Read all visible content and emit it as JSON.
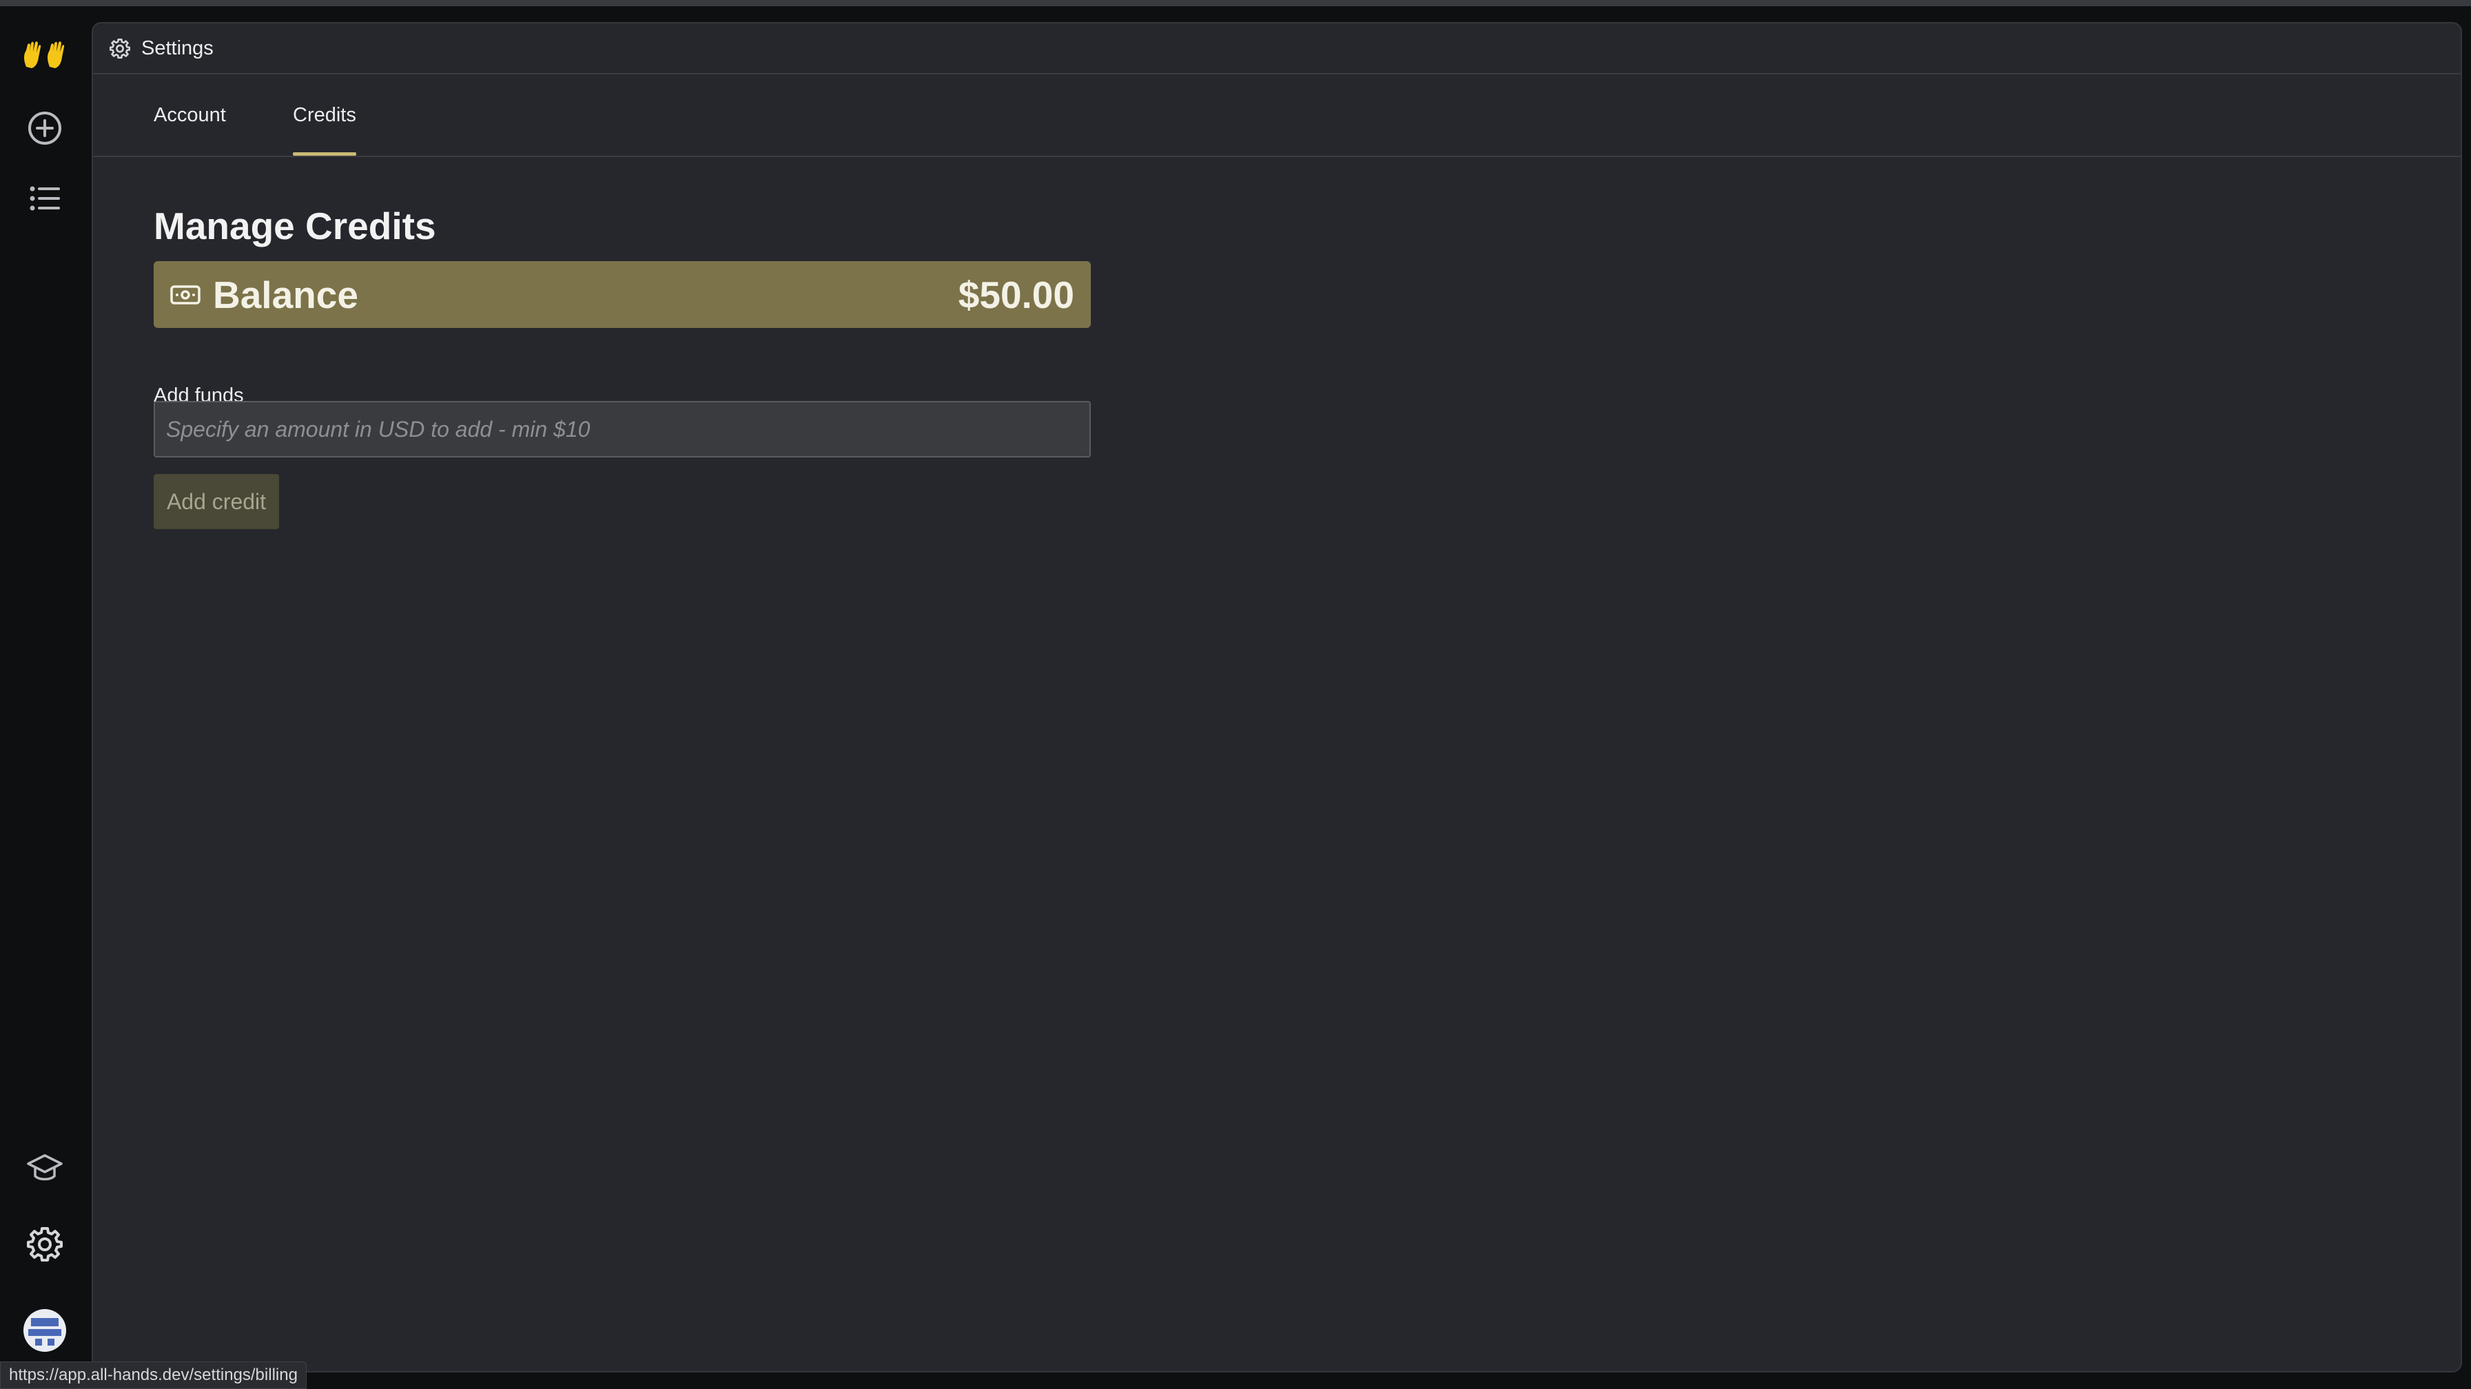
{
  "app": {
    "logo_icon": "raised-hands-icon",
    "brand_color": "#f5c518"
  },
  "sidebar": {
    "items": [
      {
        "icon": "plus-circle-icon",
        "action": "new-conversation"
      },
      {
        "icon": "list-icon",
        "action": "conversations"
      },
      {
        "icon": "graduation-cap-icon",
        "action": "docs"
      },
      {
        "icon": "gear-icon",
        "action": "settings"
      },
      {
        "icon": "avatar",
        "action": "user-menu"
      }
    ]
  },
  "header": {
    "title": "Settings",
    "icon": "gear-icon"
  },
  "tabs": [
    {
      "label": "Account",
      "active": false
    },
    {
      "label": "Credits",
      "active": true
    }
  ],
  "main": {
    "heading": "Manage Credits",
    "balance": {
      "label": "Balance",
      "amount": "$50.00",
      "icon": "banknote-icon",
      "color": "#7c734a"
    },
    "add_funds": {
      "label": "Add funds",
      "placeholder": "Specify an amount in USD to add - min $10",
      "value": ""
    },
    "add_button_label": "Add credit"
  },
  "status_bar": {
    "url": "https://app.all-hands.dev/settings/billing"
  },
  "colors": {
    "accent": "#c9b974",
    "panel_bg": "#25272d",
    "rail_bg": "#0d0f11"
  }
}
